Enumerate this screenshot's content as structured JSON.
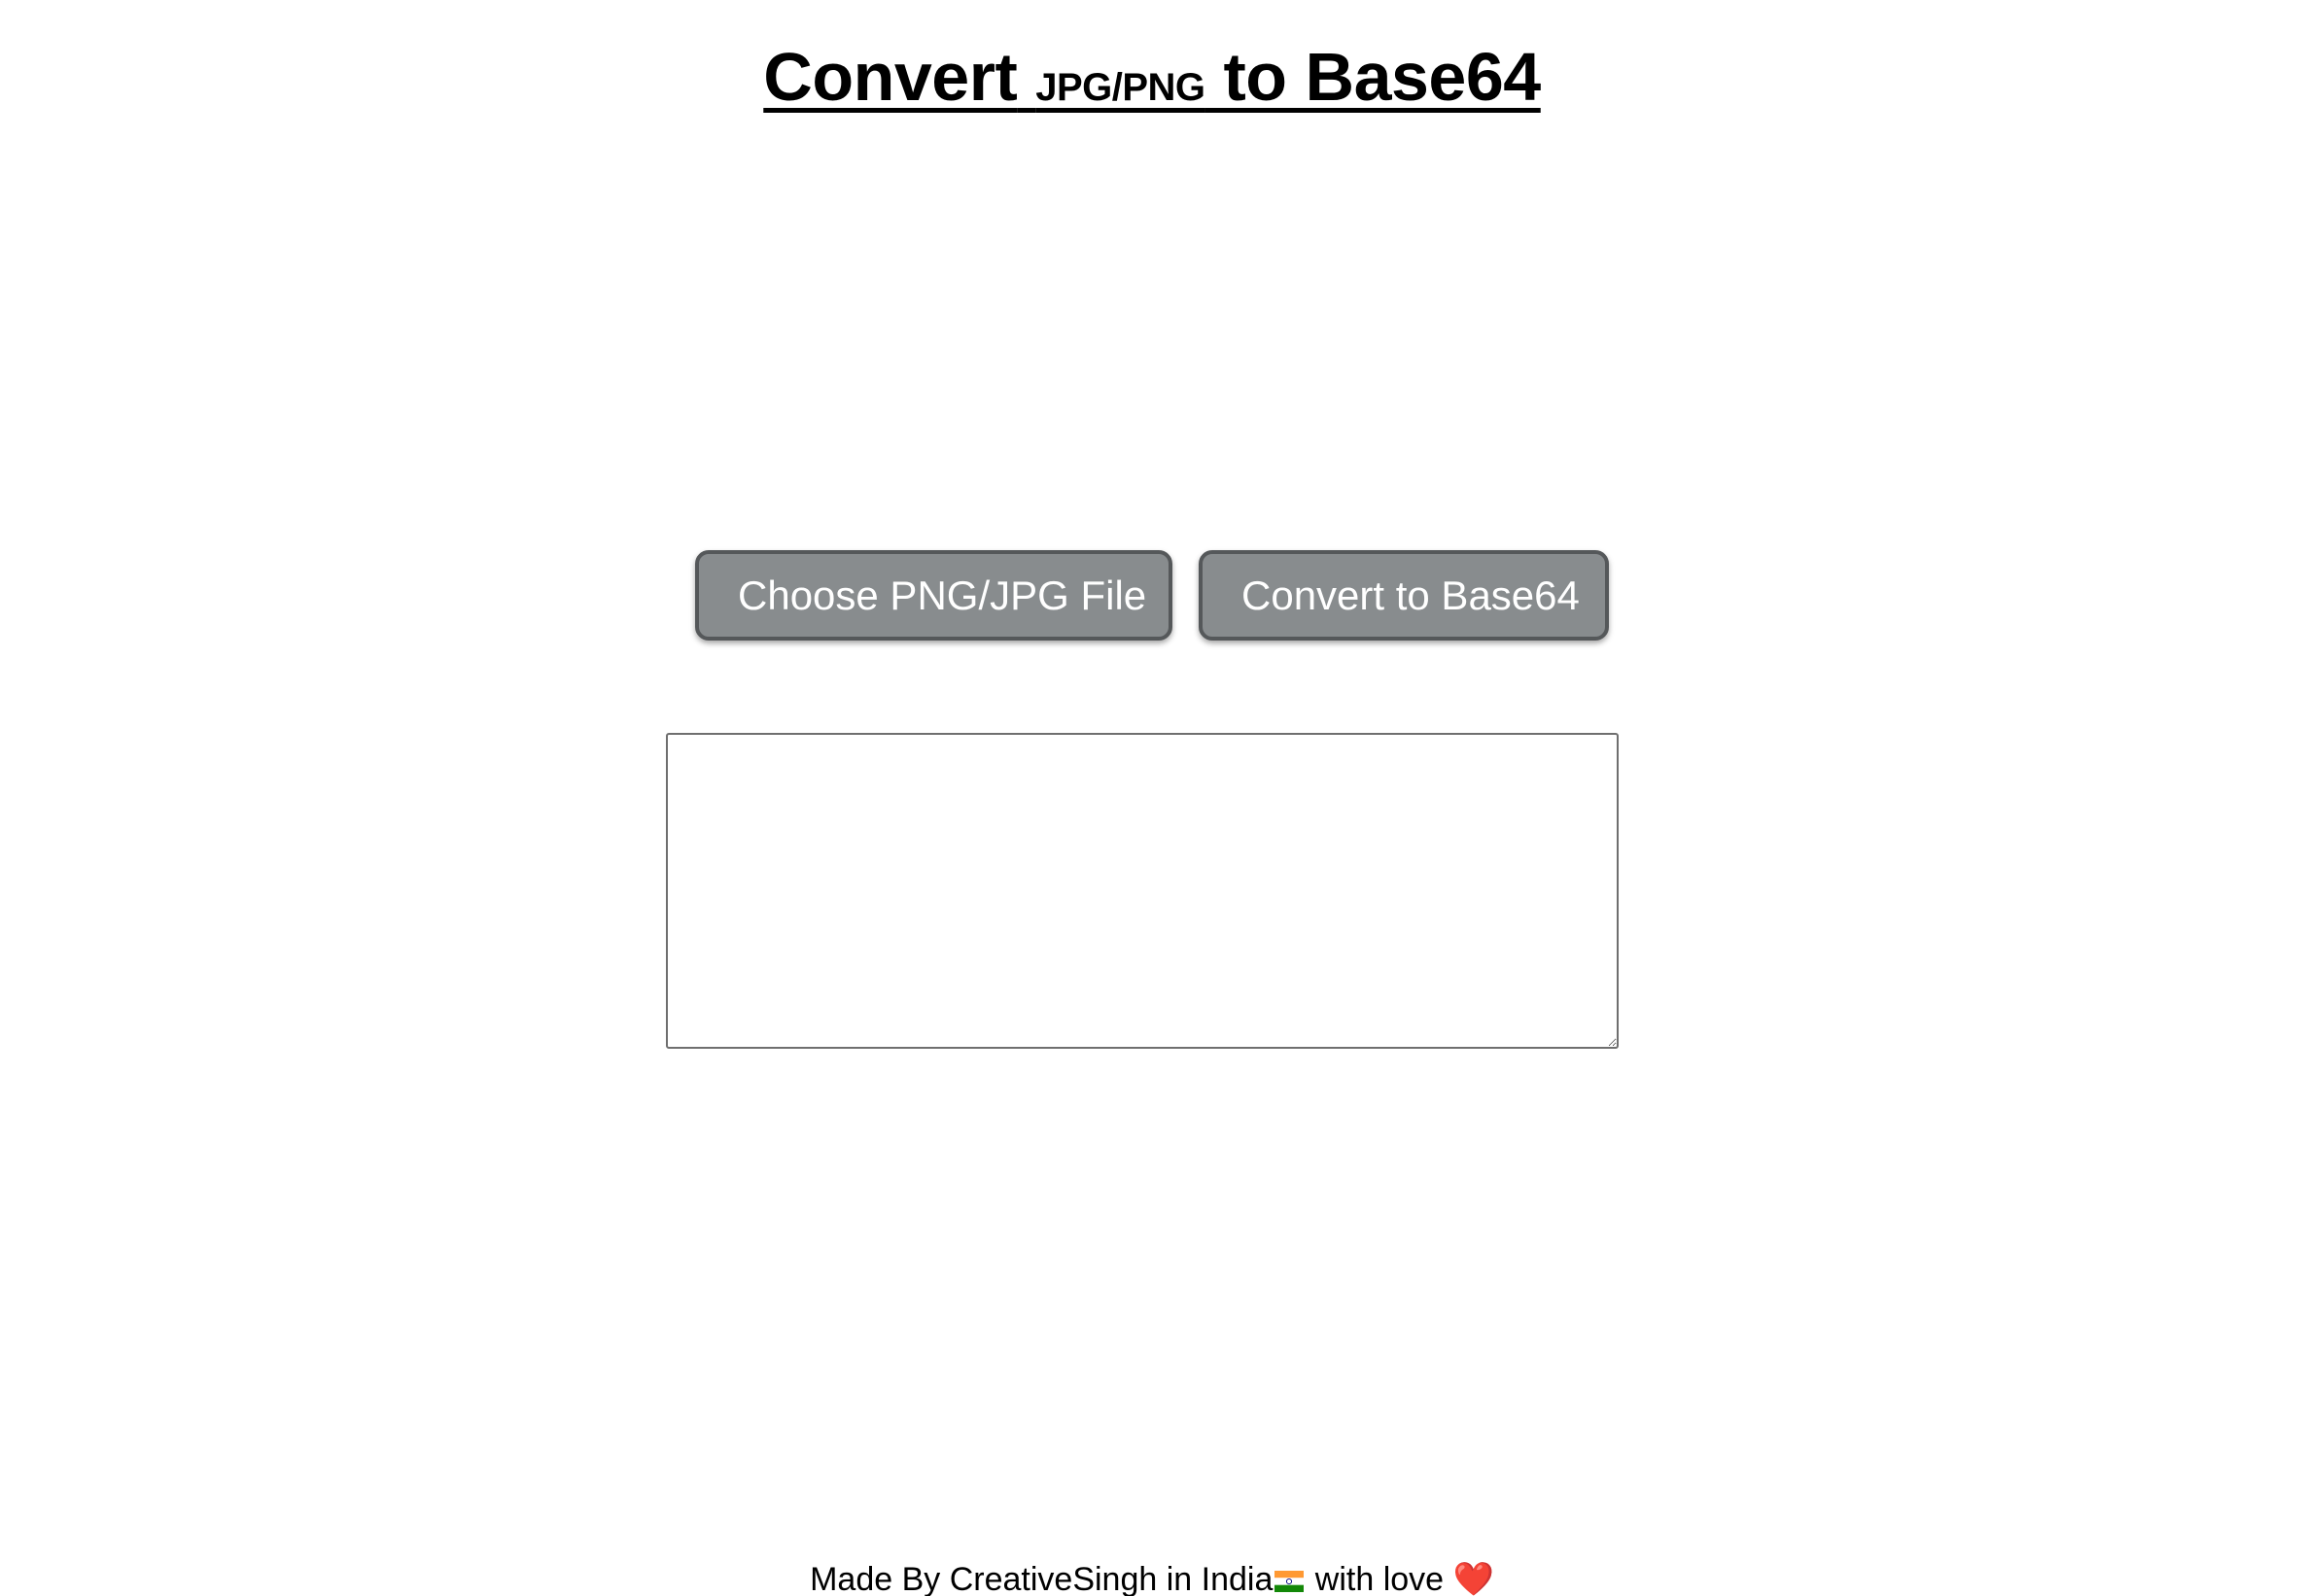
{
  "header": {
    "title_part1": "Convert",
    "title_small": "JPG/PNG",
    "title_part2": "to Base64"
  },
  "actions": {
    "choose_label": "Choose PNG/JPG File",
    "convert_label": "Convert to Base64"
  },
  "output": {
    "value": "",
    "placeholder": ""
  },
  "footer": {
    "text_before_flag": "Made By CreativeSingh in India",
    "flag_icon": "india-flag-icon",
    "text_after_flag": " with love ",
    "heart_glyph": "❤️",
    "heart_icon": "heart-icon"
  },
  "colors": {
    "button_bg": "#888c8e",
    "button_border": "#55585a",
    "button_text": "#ffffff"
  }
}
